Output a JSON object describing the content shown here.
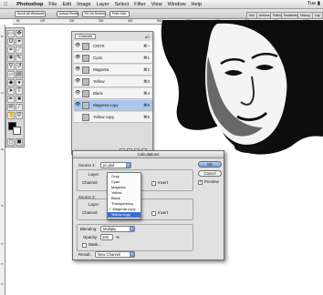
{
  "menubar": {
    "apple": "",
    "app": "Photoshop",
    "items": [
      "File",
      "Edit",
      "Image",
      "Layer",
      "Select",
      "Filter",
      "View",
      "Window",
      "Help"
    ],
    "right": "Tue ▮"
  },
  "options_bar": {
    "buttons": [
      "Scroll All Windows",
      "Actual Pixels",
      "Fit On Screen",
      "Print Size"
    ],
    "tabs": [
      "Info",
      "Actions",
      "Paths",
      "Swatches",
      "History",
      "Lay"
    ]
  },
  "channels_panel": {
    "tab": "Channels",
    "rows": [
      {
        "name": "CMYK",
        "shortcut": "⌘~",
        "selected": false,
        "eye": true
      },
      {
        "name": "Cyan",
        "shortcut": "⌘1",
        "selected": false,
        "eye": true
      },
      {
        "name": "Magenta",
        "shortcut": "⌘2",
        "selected": false,
        "eye": true
      },
      {
        "name": "Yellow",
        "shortcut": "⌘3",
        "selected": false,
        "eye": true
      },
      {
        "name": "Black",
        "shortcut": "⌘4",
        "selected": false,
        "eye": true
      },
      {
        "name": "Magenta copy",
        "shortcut": "⌘5",
        "selected": true,
        "eye": true
      },
      {
        "name": "Yellow copy",
        "shortcut": "⌘6",
        "selected": false,
        "eye": false
      }
    ]
  },
  "calculations": {
    "title": "Calculations",
    "source1_label": "Source 1:",
    "source1_value": "pc.psd",
    "layer_label": "Layer:",
    "channel_label": "Channel:",
    "invert_label": "Invert",
    "source2_label": "Source 2:",
    "layer2_label": "Layer:",
    "channel2_label": "Channel:",
    "channel2_value": "✓ Magenta copy",
    "invert2_label": "Invert",
    "blending_label": "Blending:",
    "blending_value": "Multiply",
    "opacity_label": "Opacity:",
    "opacity_value": "100",
    "opacity_unit": "%",
    "mask_label": "Mask...",
    "result_label": "Result:",
    "result_value": "New Channel",
    "ok": "OK",
    "cancel": "Cancel",
    "preview": "Preview"
  },
  "channel_menu": {
    "items": [
      "Gray",
      "Cyan",
      "Magenta",
      "Yellow",
      "Black",
      "Transparency",
      "✓ Magenta copy",
      "Yellow copy"
    ],
    "highlighted_index": 7
  },
  "rulers": {
    "top": [
      "80",
      "100",
      "200",
      "300",
      "400",
      "500",
      "600",
      "700",
      "800",
      "900",
      "1000"
    ],
    "left": [
      "6",
      "0",
      "8",
      "9",
      "1",
      "1",
      "1"
    ]
  }
}
